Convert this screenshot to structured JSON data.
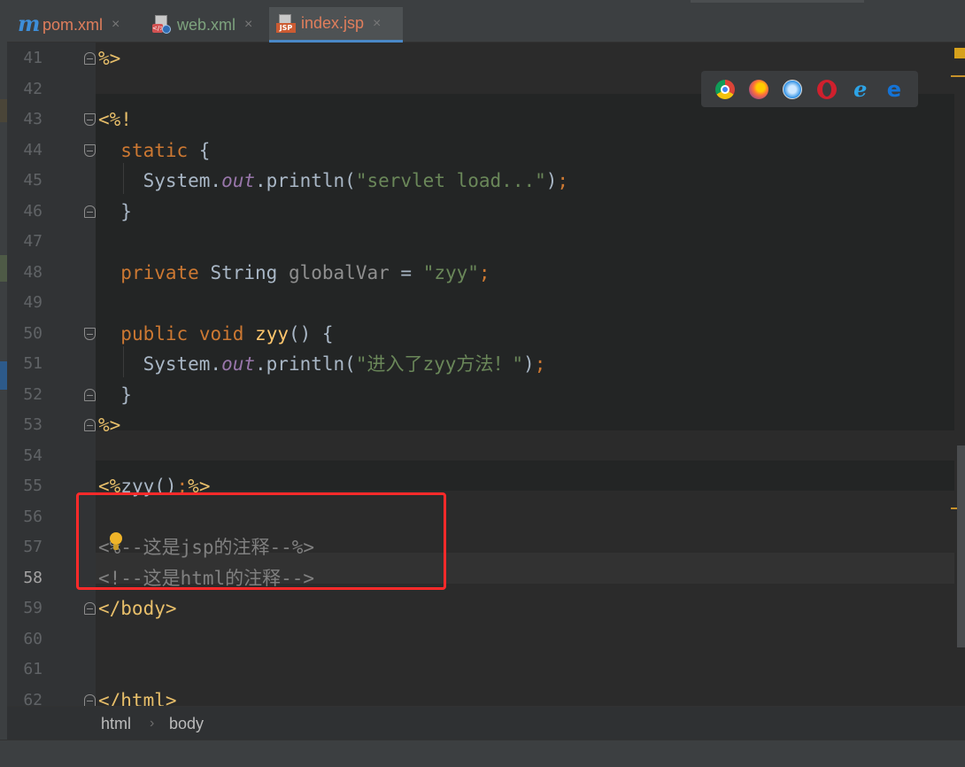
{
  "tabs": [
    {
      "label": "pom.xml",
      "icon": "maven-m-icon",
      "color": "#e07e5c",
      "active": false
    },
    {
      "label": "web.xml",
      "icon": "web-xml-file-icon",
      "color": "#7ea37e",
      "active": false
    },
    {
      "label": "index.jsp",
      "icon": "jsp-file-icon",
      "color": "#e07e5c",
      "active": true
    }
  ],
  "tab_close_glyph": "×",
  "browser_icons": [
    "chrome-icon",
    "firefox-icon",
    "safari-icon",
    "opera-icon",
    "internet-explorer-icon",
    "edge-icon"
  ],
  "editor": {
    "current_line": 58,
    "line_numbers": [
      "41",
      "42",
      "43",
      "44",
      "45",
      "46",
      "47",
      "48",
      "49",
      "50",
      "51",
      "52",
      "53",
      "54",
      "55",
      "56",
      "57",
      "58",
      "59",
      "60",
      "61",
      "62"
    ],
    "lines": [
      [
        {
          "t": "tag",
          "v": "%>"
        }
      ],
      [],
      [
        {
          "t": "tag",
          "v": "<%!"
        }
      ],
      [
        {
          "t": "plain",
          "v": "  "
        },
        {
          "t": "kw",
          "v": "static"
        },
        {
          "t": "plain",
          "v": " {"
        }
      ],
      [
        {
          "t": "plain",
          "v": "    System."
        },
        {
          "t": "fld",
          "v": "out"
        },
        {
          "t": "plain",
          "v": ".println("
        },
        {
          "t": "str",
          "v": "\"servlet load...\""
        },
        {
          "t": "plain",
          "v": ")"
        },
        {
          "t": "kw",
          "v": ";"
        }
      ],
      [
        {
          "t": "plain",
          "v": "  }"
        }
      ],
      [],
      [
        {
          "t": "plain",
          "v": "  "
        },
        {
          "t": "kw",
          "v": "private"
        },
        {
          "t": "plain",
          "v": " String "
        },
        {
          "t": "var",
          "v": "globalVar"
        },
        {
          "t": "plain",
          "v": " = "
        },
        {
          "t": "str",
          "v": "\"zyy\""
        },
        {
          "t": "kw",
          "v": ";"
        }
      ],
      [],
      [
        {
          "t": "plain",
          "v": "  "
        },
        {
          "t": "kw",
          "v": "public"
        },
        {
          "t": "plain",
          "v": " "
        },
        {
          "t": "kw",
          "v": "void"
        },
        {
          "t": "plain",
          "v": " "
        },
        {
          "t": "fn",
          "v": "zyy"
        },
        {
          "t": "plain",
          "v": "() {"
        }
      ],
      [
        {
          "t": "plain",
          "v": "    System."
        },
        {
          "t": "fld",
          "v": "out"
        },
        {
          "t": "plain",
          "v": ".println("
        },
        {
          "t": "str",
          "v": "\"进入了zyy方法！\""
        },
        {
          "t": "plain",
          "v": ")"
        },
        {
          "t": "kw",
          "v": ";"
        }
      ],
      [
        {
          "t": "plain",
          "v": "  }"
        }
      ],
      [
        {
          "t": "tag",
          "v": "%>"
        }
      ],
      [],
      [
        {
          "t": "tag",
          "v": "<%"
        },
        {
          "t": "plain",
          "v": "zyy()"
        },
        {
          "t": "kw",
          "v": ";"
        },
        {
          "t": "tag",
          "v": "%>"
        }
      ],
      [],
      [
        {
          "t": "cmt",
          "v": "<%--这是jsp的注释--%>"
        }
      ],
      [
        {
          "t": "cmt",
          "v": "<!--这是html的注释-->"
        }
      ],
      [
        {
          "t": "tag",
          "v": "</body>"
        }
      ],
      [],
      [],
      [
        {
          "t": "tag",
          "v": "</html>"
        }
      ]
    ]
  },
  "breadcrumb": [
    "html",
    "body"
  ],
  "breadcrumb_separator": "›",
  "colors": {
    "accent": "#4a88c7",
    "annotation": "#ff2a2a",
    "tag": "#e8bf6a",
    "keyword": "#cc7832",
    "string": "#6a8759",
    "comment": "#808080"
  }
}
